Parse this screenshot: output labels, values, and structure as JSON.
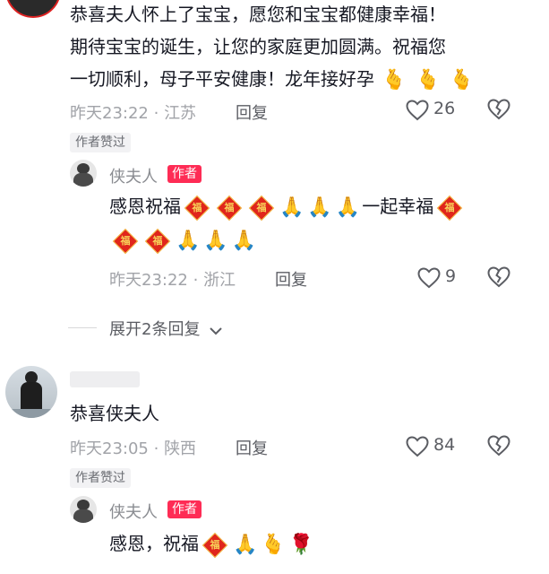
{
  "comment1": {
    "line1": "恭喜夫人怀上了宝宝，愿您和宝宝都健康幸福！",
    "line2": "期待宝宝的诞生，让您的家庭更加圆满。祝福您",
    "line3": "一切顺利，母子平安健康！龙年接好孕",
    "time": "昨天23:22",
    "location": "江苏",
    "reply": "回复",
    "likes": "26",
    "author_liked": "作者赞过"
  },
  "reply1": {
    "username": "侠夫人",
    "badge": "作者",
    "part1": "感恩祝福",
    "part2": "一起幸福",
    "fu_char": "福",
    "time": "昨天23:22",
    "location": "浙江",
    "reply": "回复",
    "likes": "9"
  },
  "expand": {
    "label": "展开2条回复"
  },
  "comment2": {
    "text": "恭喜侠夫人",
    "time": "昨天23:05",
    "location": "陕西",
    "reply": "回复",
    "likes": "84",
    "author_liked": "作者赞过"
  },
  "reply2": {
    "username": "侠夫人",
    "badge": "作者",
    "text": "感恩，祝福",
    "fu_char": "福"
  },
  "icons": {
    "heart": "heart-outline-icon",
    "dislike": "broken-heart-icon",
    "chevron": "chevron-down-icon",
    "pray": "folded-hands-emoji",
    "finger_heart": "finger-heart-emoji",
    "rose": "rose-emoji",
    "fu": "fu-diamond-emoji"
  },
  "colors": {
    "badge": "#fe2c55",
    "meta": "#a1a3a8",
    "text": "#161823"
  }
}
